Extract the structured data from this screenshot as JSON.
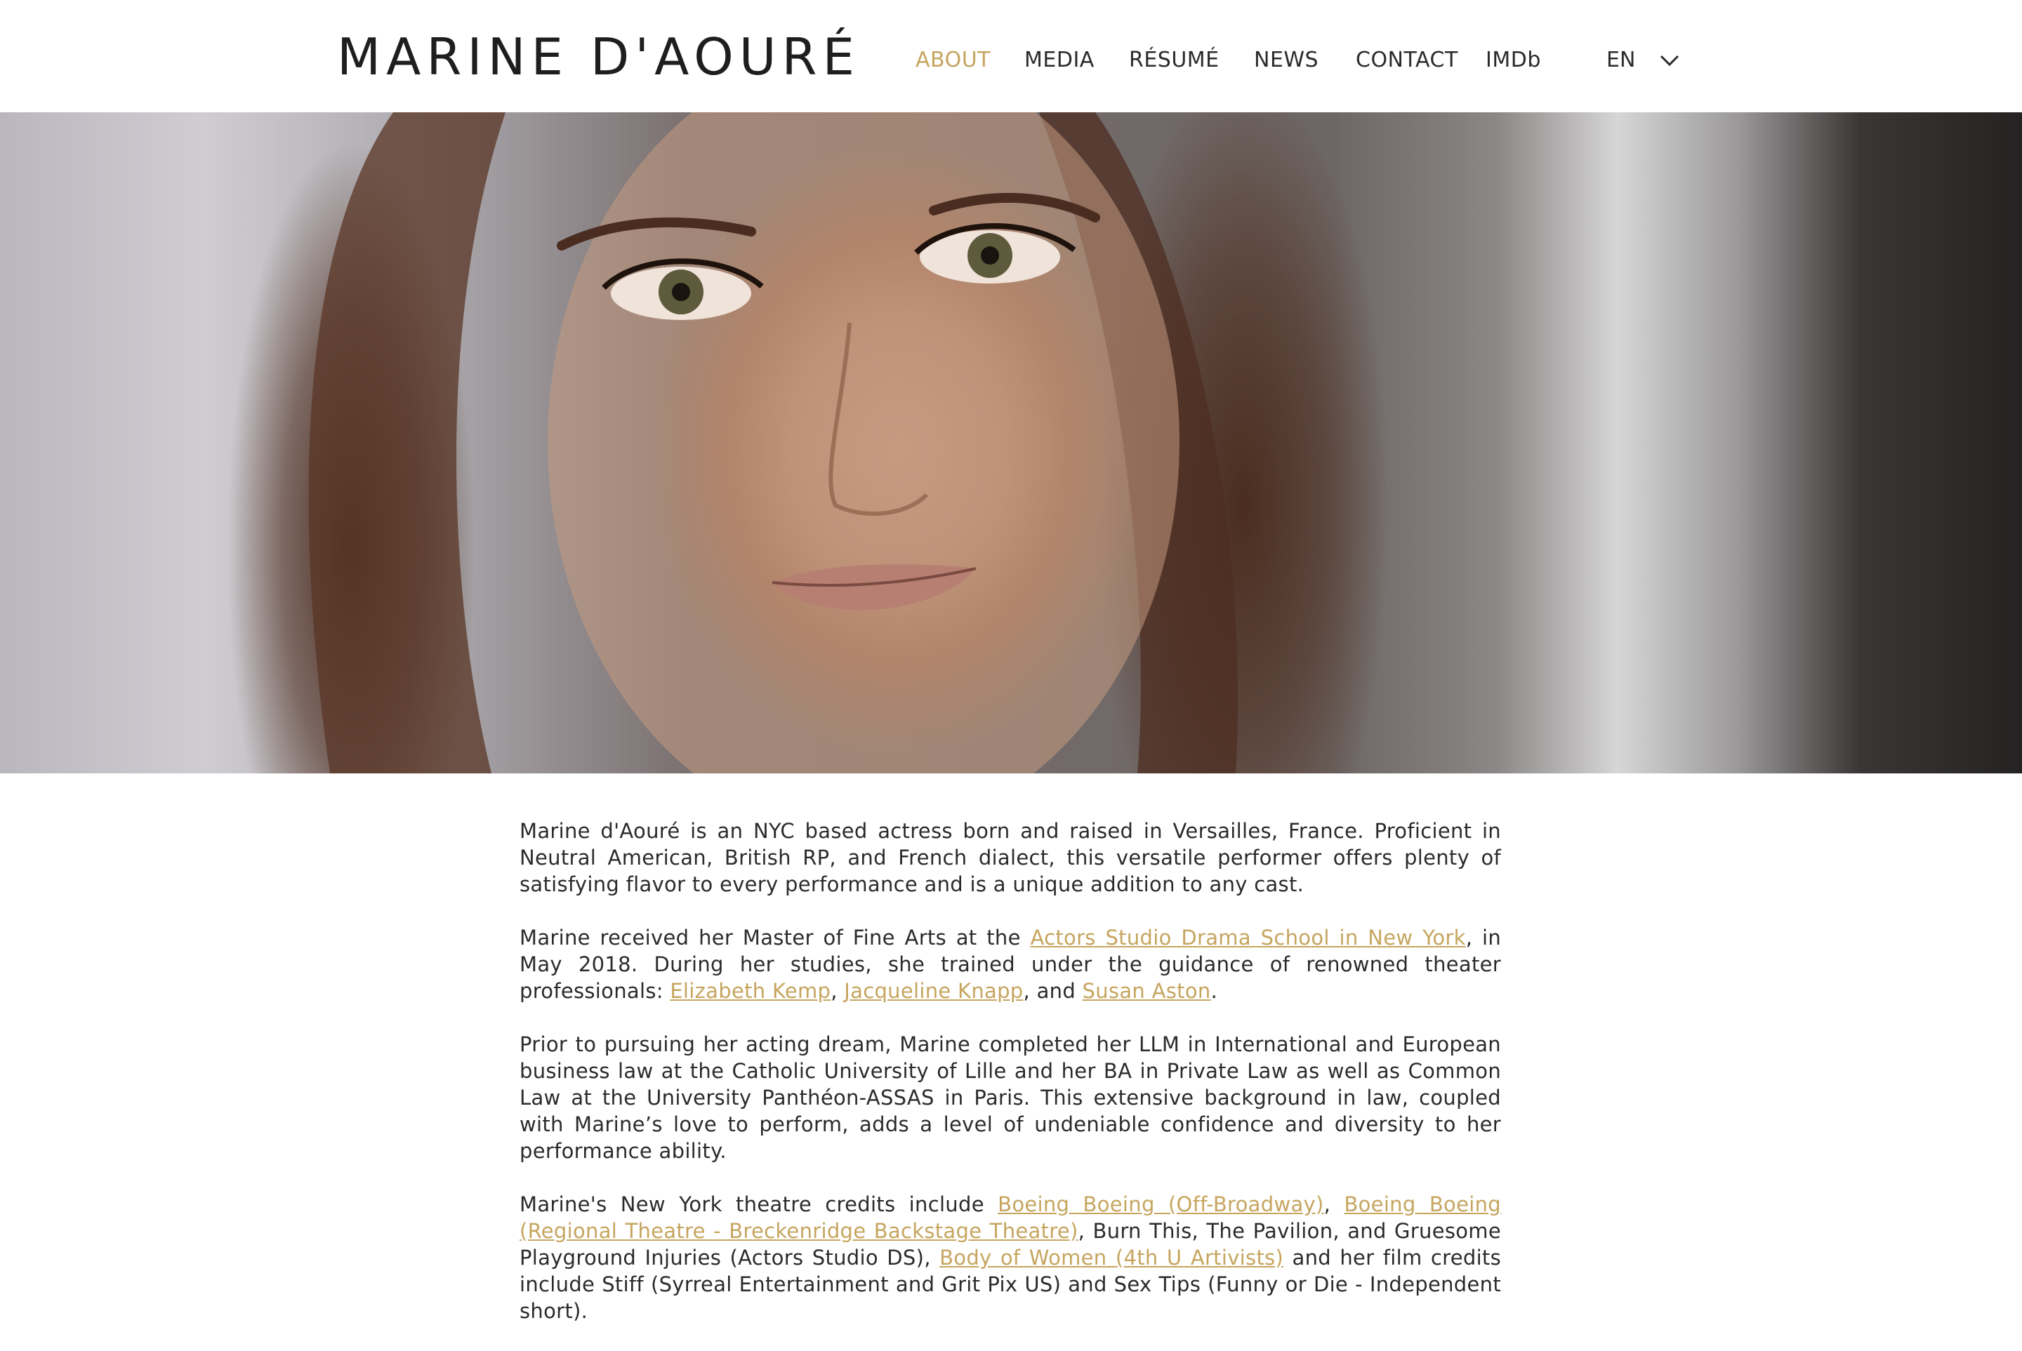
{
  "site": {
    "logo": "MARINE D'AOURÉ"
  },
  "nav": {
    "items": [
      {
        "label": "ABOUT",
        "active": true
      },
      {
        "label": "MEDIA",
        "active": false
      },
      {
        "label": "RÉSUMÉ",
        "active": false
      },
      {
        "label": "NEWS",
        "active": false
      },
      {
        "label": "CONTACT",
        "active": false
      },
      {
        "label": "IMDb",
        "active": false
      }
    ],
    "language": "EN",
    "language_icon": "chevron-down-icon"
  },
  "hero": {
    "image": "portrait photo of Marine d'Aouré"
  },
  "about": {
    "p1": "Marine d'Aouré is an NYC based actress born and raised in Versailles, France. Proficient in Neutral American, British RP, and French dialect, this versatile performer offers plenty of satisfying flavor to every performance and is a unique addition to any cast.",
    "p2": {
      "t1": "Marine received her Master of Fine Arts at the ",
      "link1": "Actors Studio Drama School in New York",
      "t2": ", in May 2018. During her studies, she trained under the guidance of renowned theater professionals: ",
      "link2": "Elizabeth Kemp",
      "t3": ", ",
      "link3": "Jacqueline Knapp",
      "t4": ", and ",
      "link4": "Susan Aston",
      "t5": "."
    },
    "p3": "Prior to pursuing her acting dream, Marine completed her LLM in International and European business law at the Catholic University of Lille and her BA in Private Law as well as Common Law at the University Panthéon-ASSAS in Paris. This extensive background in law, coupled with Marine’s love to perform, adds a level of undeniable confidence and diversity to her performance ability.",
    "p4": {
      "t1": "Marine's New York theatre credits include ",
      "link1": "Boeing Boeing (Off-Broadway)",
      "t2": ", ",
      "link2": "Boeing Boeing (Regional Theatre - Breckenridge Backstage Theatre)",
      "t3": ", Burn This, The Pavilion, and Gruesome Playground Injuries (Actors Studio DS), ",
      "link3": "Body of Women (4th U Artivists)",
      "t4": " and her film credits include Stiff (Syrreal Entertainment and Grit Pix US) and Sex Tips (Funny or Die - Independent short)."
    }
  },
  "colors": {
    "accent": "#c6a55f",
    "text": "#2b2b2b",
    "background": "#ffffff"
  }
}
